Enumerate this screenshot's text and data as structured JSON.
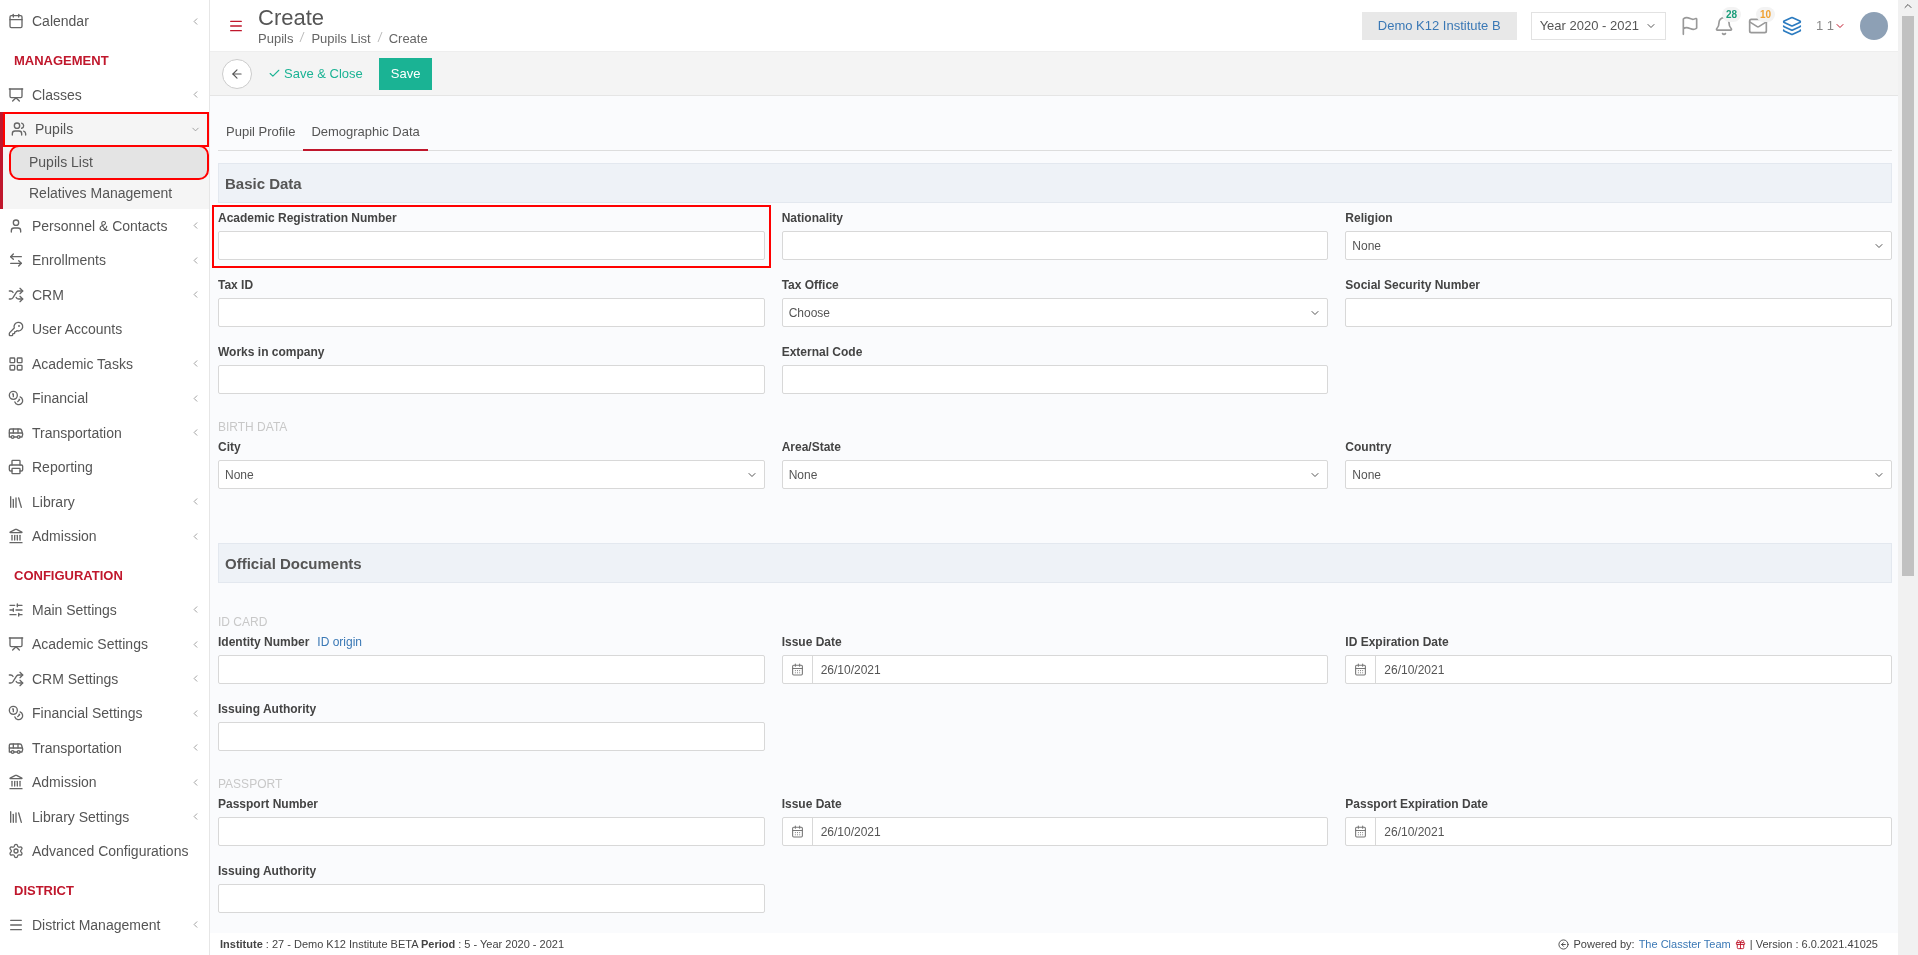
{
  "sidebar": {
    "items": [
      {
        "kind": "item",
        "label": "Calendar",
        "expandable": true,
        "expanded": false,
        "highlighted": false
      },
      {
        "kind": "header",
        "label": "MANAGEMENT"
      },
      {
        "kind": "item",
        "label": "Classes",
        "expandable": true,
        "expanded": false,
        "highlighted": false
      },
      {
        "kind": "item",
        "label": "Pupils",
        "expandable": true,
        "expanded": true,
        "highlighted": true,
        "children": [
          {
            "label": "Pupils List",
            "selected": true,
            "highlighted": true
          },
          {
            "label": "Relatives Management",
            "selected": false,
            "highlighted": false
          }
        ]
      },
      {
        "kind": "item",
        "label": "Personnel & Contacts",
        "expandable": true,
        "expanded": false,
        "highlighted": false
      },
      {
        "kind": "item",
        "label": "Enrollments",
        "expandable": true,
        "expanded": false,
        "highlighted": false
      },
      {
        "kind": "item",
        "label": "CRM",
        "expandable": true,
        "expanded": false,
        "highlighted": false
      },
      {
        "kind": "item",
        "label": "User Accounts",
        "expandable": false,
        "expanded": false,
        "highlighted": false
      },
      {
        "kind": "item",
        "label": "Academic Tasks",
        "expandable": true,
        "expanded": false,
        "highlighted": false
      },
      {
        "kind": "item",
        "label": "Financial",
        "expandable": true,
        "expanded": false,
        "highlighted": false
      },
      {
        "kind": "item",
        "label": "Transportation",
        "expandable": true,
        "expanded": false,
        "highlighted": false
      },
      {
        "kind": "item",
        "label": "Reporting",
        "expandable": false,
        "expanded": false,
        "highlighted": false
      },
      {
        "kind": "item",
        "label": "Library",
        "expandable": true,
        "expanded": false,
        "highlighted": false
      },
      {
        "kind": "item",
        "label": "Admission",
        "expandable": true,
        "expanded": false,
        "highlighted": false
      },
      {
        "kind": "header",
        "label": "CONFIGURATION"
      },
      {
        "kind": "item",
        "label": "Main Settings",
        "expandable": true,
        "expanded": false,
        "highlighted": false
      },
      {
        "kind": "item",
        "label": "Academic Settings",
        "expandable": true,
        "expanded": false,
        "highlighted": false
      },
      {
        "kind": "item",
        "label": "CRM Settings",
        "expandable": true,
        "expanded": false,
        "highlighted": false
      },
      {
        "kind": "item",
        "label": "Financial Settings",
        "expandable": true,
        "expanded": false,
        "highlighted": false
      },
      {
        "kind": "item",
        "label": "Transportation",
        "expandable": true,
        "expanded": false,
        "highlighted": false
      },
      {
        "kind": "item",
        "label": "Admission",
        "expandable": true,
        "expanded": false,
        "highlighted": false
      },
      {
        "kind": "item",
        "label": "Library Settings",
        "expandable": true,
        "expanded": false,
        "highlighted": false
      },
      {
        "kind": "item",
        "label": "Advanced Configurations",
        "expandable": false,
        "expanded": false,
        "highlighted": false
      },
      {
        "kind": "header",
        "label": "DISTRICT"
      },
      {
        "kind": "item",
        "label": "District Management",
        "expandable": true,
        "expanded": false,
        "highlighted": false
      }
    ]
  },
  "header": {
    "title": "Create",
    "breadcrumb": [
      "Pupils",
      "Pupils List",
      "Create"
    ],
    "institute": "Demo K12 Institute B",
    "year": "Year 2020 - 2021",
    "notifications": "28",
    "messages": "10",
    "user": "1 1"
  },
  "toolbar": {
    "save_close": "Save & Close",
    "save": "Save"
  },
  "tabs": [
    {
      "label": "Pupil Profile",
      "selected": false
    },
    {
      "label": "Demographic Data",
      "selected": true
    }
  ],
  "sections": [
    {
      "title": "Basic Data",
      "blocks": [
        {
          "kind": "row",
          "fields": [
            {
              "label": "Academic Registration Number",
              "kind": "text",
              "highlighted": true
            },
            {
              "label": "Nationality",
              "kind": "text",
              "highlighted": false
            },
            {
              "label": "Religion",
              "kind": "select",
              "value": "None",
              "highlighted": false
            }
          ]
        },
        {
          "kind": "row",
          "fields": [
            {
              "label": "Tax ID",
              "kind": "text",
              "highlighted": false
            },
            {
              "label": "Tax Office",
              "kind": "select",
              "value": "Choose",
              "highlighted": false
            },
            {
              "label": "Social Security Number",
              "kind": "text",
              "highlighted": false
            }
          ]
        },
        {
          "kind": "row",
          "fields": [
            {
              "label": "Works in company",
              "kind": "text",
              "highlighted": false
            },
            {
              "label": "External Code",
              "kind": "text",
              "highlighted": false
            }
          ]
        },
        {
          "kind": "subheading",
          "text": "BIRTH DATA"
        },
        {
          "kind": "row",
          "fields": [
            {
              "label": "City",
              "kind": "select",
              "value": "None",
              "highlighted": false
            },
            {
              "label": "Area/State",
              "kind": "select",
              "value": "None",
              "highlighted": false
            },
            {
              "label": "Country",
              "kind": "select",
              "value": "None",
              "highlighted": false
            }
          ]
        }
      ]
    },
    {
      "title": "Official Documents",
      "blocks": [
        {
          "kind": "subheading",
          "text": "ID CARD"
        },
        {
          "kind": "row",
          "fields": [
            {
              "label": "Identity Number",
              "link": "ID origin",
              "kind": "text",
              "highlighted": false
            },
            {
              "label": "Issue Date",
              "kind": "date",
              "value": "26/10/2021",
              "highlighted": false
            },
            {
              "label": "ID Expiration Date",
              "kind": "date",
              "value": "26/10/2021",
              "highlighted": false
            }
          ]
        },
        {
          "kind": "row",
          "fields": [
            {
              "label": "Issuing Authority",
              "kind": "text",
              "highlighted": false
            }
          ]
        },
        {
          "kind": "subheading",
          "text": "PASSPORT"
        },
        {
          "kind": "row",
          "fields": [
            {
              "label": "Passport Number",
              "kind": "text",
              "highlighted": false
            },
            {
              "label": "Issue Date",
              "kind": "date",
              "value": "26/10/2021",
              "highlighted": false
            },
            {
              "label": "Passport Expiration Date",
              "kind": "date",
              "value": "26/10/2021",
              "highlighted": false
            }
          ]
        },
        {
          "kind": "row",
          "fields": [
            {
              "label": "Issuing Authority",
              "kind": "text",
              "highlighted": false
            }
          ]
        }
      ]
    }
  ],
  "footer": {
    "info": "**Institute** : 27 - Demo K12 Institute BETA **Period** : 5 - Year 2020 - 2021",
    "powered": "Powered by:",
    "team": "The Classter Team",
    "version": "| Version : 6.0.2021.41025"
  }
}
